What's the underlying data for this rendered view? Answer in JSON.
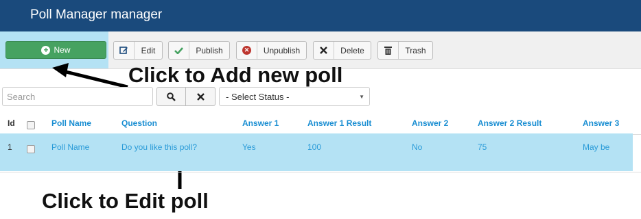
{
  "header": {
    "title": "Poll Manager manager"
  },
  "toolbar": {
    "new_label": "New",
    "edit_label": "Edit",
    "publish_label": "Publish",
    "unpublish_label": "Unpublish",
    "delete_label": "Delete",
    "trash_label": "Trash"
  },
  "annotations": {
    "add_poll": "Click to Add new poll",
    "edit_poll": "Click to Edit poll"
  },
  "filters": {
    "search_placeholder": "Search",
    "status_selected": "- Select Status -"
  },
  "table": {
    "headers": [
      "Id",
      "Poll Name",
      "Question",
      "Answer 1",
      "Answer 1 Result",
      "Answer 2",
      "Answer 2 Result",
      "Answer 3"
    ],
    "rows": [
      {
        "id": "1",
        "poll_name": "Poll Name",
        "question": "Do you like this poll?",
        "answer1": "Yes",
        "answer1_result": "100",
        "answer2": "No",
        "answer2_result": "75",
        "answer3": "May be"
      }
    ]
  },
  "colors": {
    "header_bg": "#1a4a7c",
    "new_button": "#46a261",
    "highlight": "#b4e2f4",
    "link": "#1a8ed2"
  }
}
